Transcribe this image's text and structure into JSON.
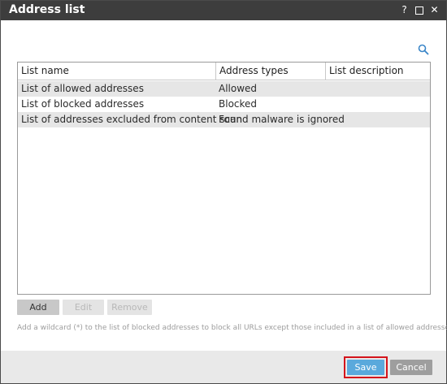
{
  "window": {
    "title": "Address list",
    "controls": {
      "help": "?",
      "close": "✕"
    }
  },
  "table": {
    "columns": [
      "List name",
      "Address types",
      "List description"
    ],
    "rows": [
      {
        "name": "List of allowed addresses",
        "type": "Allowed",
        "description": ""
      },
      {
        "name": "List of blocked addresses",
        "type": "Blocked",
        "description": ""
      },
      {
        "name": "List of addresses excluded from content scan",
        "type": "Found malware is ignored",
        "description": ""
      }
    ]
  },
  "actions": {
    "add": "Add",
    "edit": "Edit",
    "remove": "Remove"
  },
  "hint": "Add a wildcard (*) to the list of blocked addresses to block all URLs except those included in a list of allowed addresses.",
  "footer": {
    "save": "Save",
    "cancel": "Cancel"
  },
  "colors": {
    "titlebar": "#3d3d3d",
    "accent": "#5aa9dc",
    "highlight_outline": "#d4141c",
    "row_alt": "#e6e6e6"
  },
  "icons": {
    "search": "search-icon",
    "help": "help-icon",
    "maximize": "maximize-icon",
    "close": "close-icon"
  }
}
